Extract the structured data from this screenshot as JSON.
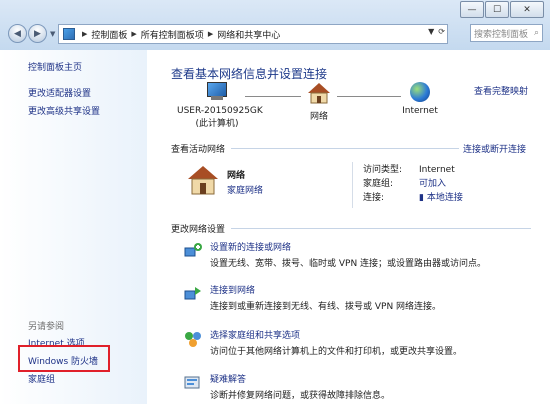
{
  "window": {
    "minimize": "—",
    "maximize": "☐",
    "close": "✕"
  },
  "address": {
    "crumbs": [
      "控制面板",
      "所有控制面板项",
      "网络和共享中心"
    ],
    "refresh": "⟳"
  },
  "search": {
    "placeholder": "搜索控制面板"
  },
  "sidebar": {
    "home": "控制面板主页",
    "items": [
      "更改适配器设置",
      "更改高级共享设置"
    ],
    "see_also": "另请参阅",
    "links": [
      "Internet 选项",
      "Windows 防火墙",
      "家庭组"
    ]
  },
  "main": {
    "heading": "查看基本网络信息并设置连接",
    "full_map": "查看完整映射",
    "nodes": {
      "computer": "USER-20150925GK",
      "computer_sub": "(此计算机)",
      "network": "网络",
      "internet": "Internet"
    },
    "active_title": "查看活动网络",
    "connect_link": "连接或断开连接",
    "network": {
      "name": "网络",
      "type": "家庭网络"
    },
    "props": {
      "access_k": "访问类型:",
      "access_v": "Internet",
      "homegroup_k": "家庭组:",
      "homegroup_v": "可加入",
      "conn_k": "连接:",
      "conn_v": "本地连接"
    },
    "change_title": "更改网络设置",
    "tasks": [
      {
        "link": "设置新的连接或网络",
        "desc": "设置无线、宽带、拨号、临时或 VPN 连接；或设置路由器或访问点。"
      },
      {
        "link": "连接到网络",
        "desc": "连接到或重新连接到无线、有线、拨号或 VPN 网络连接。"
      },
      {
        "link": "选择家庭组和共享选项",
        "desc": "访问位于其他网络计算机上的文件和打印机，或更改共享设置。"
      },
      {
        "link": "疑难解答",
        "desc": "诊断并修复网络问题，或获得故障排除信息。"
      }
    ]
  }
}
